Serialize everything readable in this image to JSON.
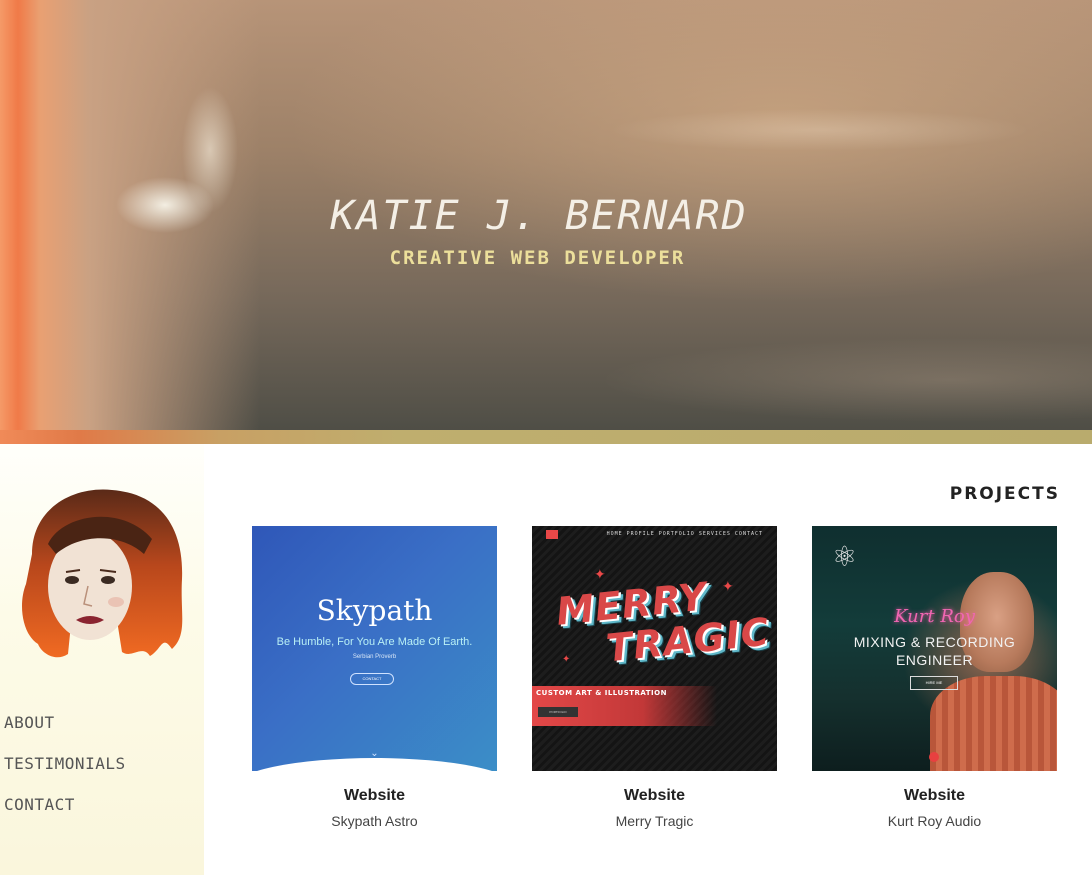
{
  "hero": {
    "name": "KATIE J. BERNARD",
    "tagline": "CREATIVE WEB DEVELOPER"
  },
  "sidebar": {
    "nav": [
      {
        "label": "ABOUT"
      },
      {
        "label": "TESTIMONIALS"
      },
      {
        "label": "CONTACT"
      }
    ]
  },
  "projects": {
    "heading": "PROJECTS",
    "items": [
      {
        "type": "Website",
        "name": "Skypath Astro",
        "thumb": {
          "title": "Skypath",
          "subtitle": "Be Humble, For You Are Made Of Earth.",
          "small": "Serbian Proverb",
          "button": "CONTACT"
        }
      },
      {
        "type": "Website",
        "name": "Merry Tragic",
        "thumb": {
          "nav": "HOME  PROFILE  PORTFOLIO  SERVICES  CONTACT",
          "word1": "MERRY",
          "word2": "TRAGIC",
          "band": "CUSTOM ART & ILLUSTRATION",
          "button": "PORTFOLIO"
        }
      },
      {
        "type": "Website",
        "name": "Kurt Roy Audio",
        "thumb": {
          "script": "Kurt Roy",
          "title_line1": "MIXING & RECORDING",
          "title_line2": "ENGINEER",
          "button": "HIRE ME"
        }
      }
    ]
  },
  "colors": {
    "tagline": "#ecdf9b",
    "stripe": "#b9ab6d",
    "sidebar_bg": "#faf6dc"
  }
}
